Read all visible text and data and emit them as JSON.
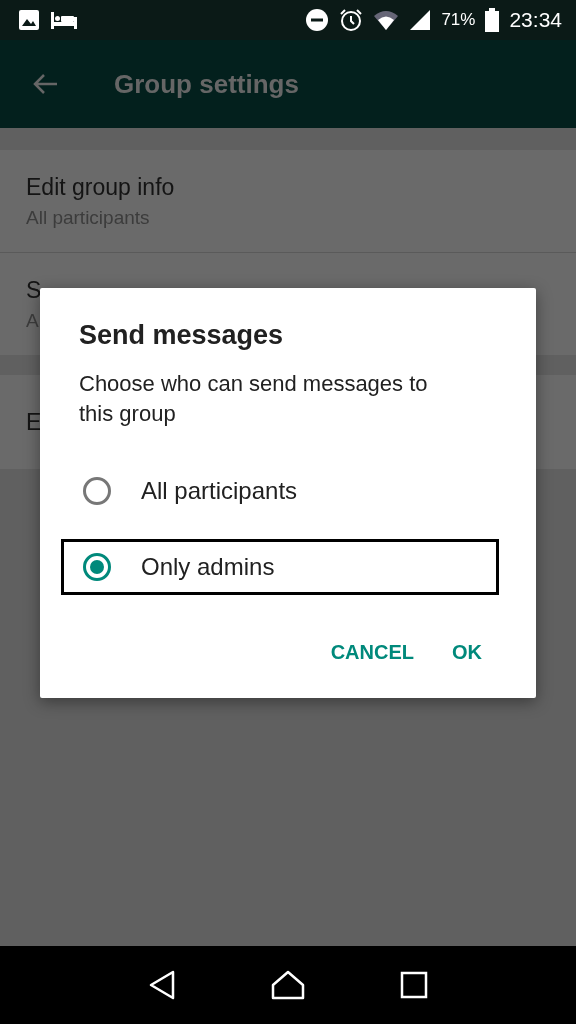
{
  "status_bar": {
    "battery": "71%",
    "time": "23:34"
  },
  "toolbar": {
    "title": "Group settings"
  },
  "settings": [
    {
      "title": "Edit group info",
      "subtitle": "All participants"
    },
    {
      "title": "S",
      "subtitle": "A"
    }
  ],
  "settings_2": [
    {
      "title": "E"
    }
  ],
  "dialog": {
    "title": "Send messages",
    "message": "Choose who can send messages to this group",
    "options": [
      {
        "label": "All participants",
        "selected": false,
        "focused": false
      },
      {
        "label": "Only admins",
        "selected": true,
        "focused": true
      }
    ],
    "buttons": [
      "CANCEL",
      "OK"
    ]
  }
}
